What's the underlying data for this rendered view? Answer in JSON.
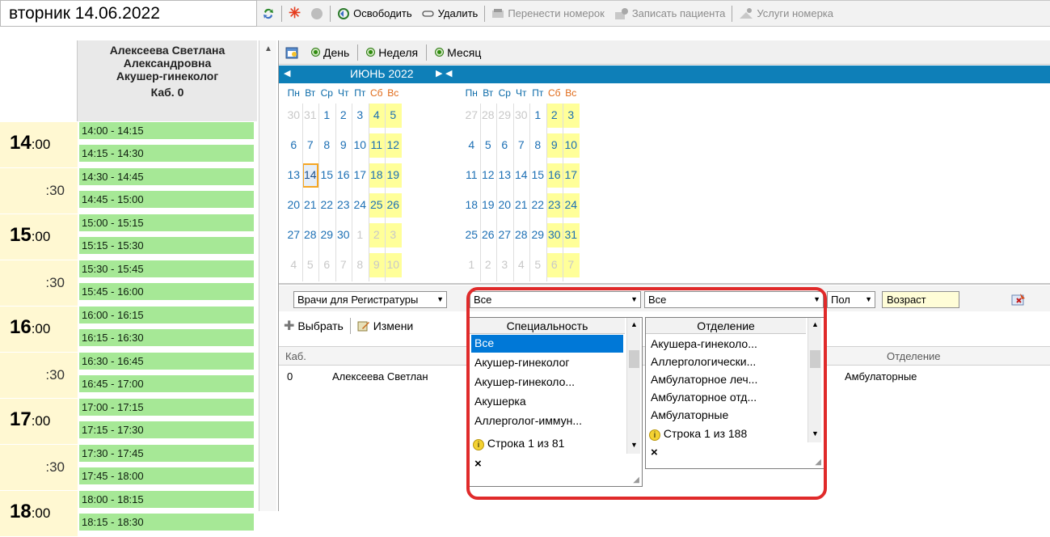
{
  "header": {
    "date": "вторник 14.06.2022"
  },
  "toolbar": {
    "release_label": "Освободить",
    "delete_label": "Удалить",
    "move_label": "Перенести номерок",
    "book_label": "Записать пациента",
    "services_label": "Услуги номерка"
  },
  "doctor": {
    "line1": "Алексеева Светлана",
    "line2": "Александровна",
    "line3": "Акушер-гинеколог",
    "line4": "Каб. 0"
  },
  "times": [
    {
      "hour": "14",
      "min": ":00"
    },
    {
      "half": ":30"
    },
    {
      "hour": "15",
      "min": ":00"
    },
    {
      "half": ":30"
    },
    {
      "hour": "16",
      "min": ":00"
    },
    {
      "half": ":30"
    },
    {
      "hour": "17",
      "min": ":00"
    },
    {
      "half": ":30"
    },
    {
      "hour": "18",
      "min": ":00"
    }
  ],
  "slots": [
    "14:00 - 14:15",
    "14:15 - 14:30",
    "14:30 - 14:45",
    "14:45 - 15:00",
    "15:00 - 15:15",
    "15:15 - 15:30",
    "15:30 - 15:45",
    "15:45 - 16:00",
    "16:00 - 16:15",
    "16:15 - 16:30",
    "16:30 - 16:45",
    "16:45 - 17:00",
    "17:00 - 17:15",
    "17:15 - 17:30",
    "17:30 - 17:45",
    "17:45 - 18:00",
    "18:00 - 18:15",
    "18:15 - 18:30"
  ],
  "view_tabs": {
    "day": "День",
    "week": "Неделя",
    "month": "Месяц"
  },
  "calendar": {
    "month_label": "ИЮНЬ 2022",
    "dows": [
      "Пн",
      "Вт",
      "Ср",
      "Чт",
      "Пт",
      "Сб",
      "Вс"
    ],
    "june": [
      [
        "30",
        "31",
        "1",
        "2",
        "3",
        "4",
        "5"
      ],
      [
        "6",
        "7",
        "8",
        "9",
        "10",
        "11",
        "12"
      ],
      [
        "13",
        "14",
        "15",
        "16",
        "17",
        "18",
        "19"
      ],
      [
        "20",
        "21",
        "22",
        "23",
        "24",
        "25",
        "26"
      ],
      [
        "27",
        "28",
        "29",
        "30",
        "1",
        "2",
        "3"
      ],
      [
        "4",
        "5",
        "6",
        "7",
        "8",
        "9",
        "10"
      ]
    ],
    "july": [
      [
        "27",
        "28",
        "29",
        "30",
        "1",
        "2",
        "3"
      ],
      [
        "4",
        "5",
        "6",
        "7",
        "8",
        "9",
        "10"
      ],
      [
        "11",
        "12",
        "13",
        "14",
        "15",
        "16",
        "17"
      ],
      [
        "18",
        "19",
        "20",
        "21",
        "22",
        "23",
        "24"
      ],
      [
        "25",
        "26",
        "27",
        "28",
        "29",
        "30",
        "31"
      ],
      [
        "1",
        "2",
        "3",
        "4",
        "5",
        "6",
        "7"
      ]
    ],
    "today": "14"
  },
  "filters": {
    "doctors_combo": "Врачи для Регистратуры",
    "specialty_combo": "Все",
    "department_combo": "Все",
    "sex_combo": "Пол",
    "age_label": "Возраст"
  },
  "actions": {
    "select_label": "Выбрать",
    "edit_label": "Измени"
  },
  "grid": {
    "col_cab": "Каб.",
    "col_dept": "Отделение",
    "row_cab": "0",
    "row_name": "Алексеева Светлан",
    "row_dept": "Амбулаторные"
  },
  "specialty_popup": {
    "header": "Специальность",
    "items": [
      "Все",
      "Акушер-гинеколог",
      "Акушер-гинеколо...",
      "Акушерка",
      "Аллерголог-иммун..."
    ],
    "footer": "Строка 1 из 81",
    "close": "×"
  },
  "department_popup": {
    "header": "Отделение",
    "items": [
      "Акушера-гинеколо...",
      "Аллергологически...",
      "Амбулаторное леч...",
      "Амбулаторное отд...",
      "Амбулаторные"
    ],
    "footer": "Строка 1 из 188",
    "close": "×"
  },
  "colors": {
    "slot_green": "#a6e896",
    "time_yellow": "#fff8d2",
    "calendar_blue": "#0e7fb8",
    "highlight_red": "#e02a2a"
  }
}
